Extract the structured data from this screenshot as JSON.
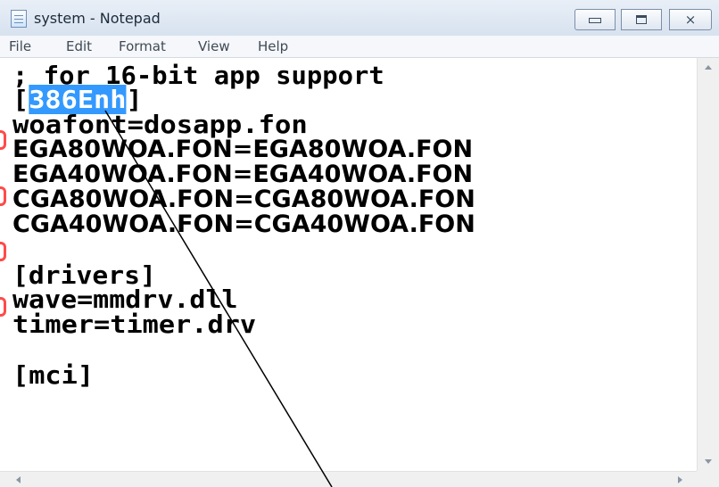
{
  "window": {
    "title": "system - Notepad",
    "controls": {
      "minimize": "minimize",
      "maximize": "maximize",
      "close": "×"
    }
  },
  "menu": [
    "File",
    "Edit",
    "Format",
    "View",
    "Help"
  ],
  "editor": {
    "lines": [
      "; for 16-bit app support",
      "[386Enh]",
      "woafont=dosapp.fon",
      "EGA80WOA.FON=EGA80WOA.FON",
      "EGA40WOA.FON=EGA40WOA.FON",
      "CGA80WOA.FON=CGA80WOA.FON",
      "CGA40WOA.FON=CGA40WOA.FON",
      "",
      "[drivers]",
      "wave=mmdrv.dll",
      "timer=timer.drv",
      "",
      "[mci]"
    ],
    "selection": {
      "open_bracket": "[",
      "text": "386Enh",
      "close_bracket": "]"
    }
  },
  "colors": {
    "selection": "#3399ff",
    "annotation_line": "#000000",
    "red_marks": "#ff4a4a"
  }
}
